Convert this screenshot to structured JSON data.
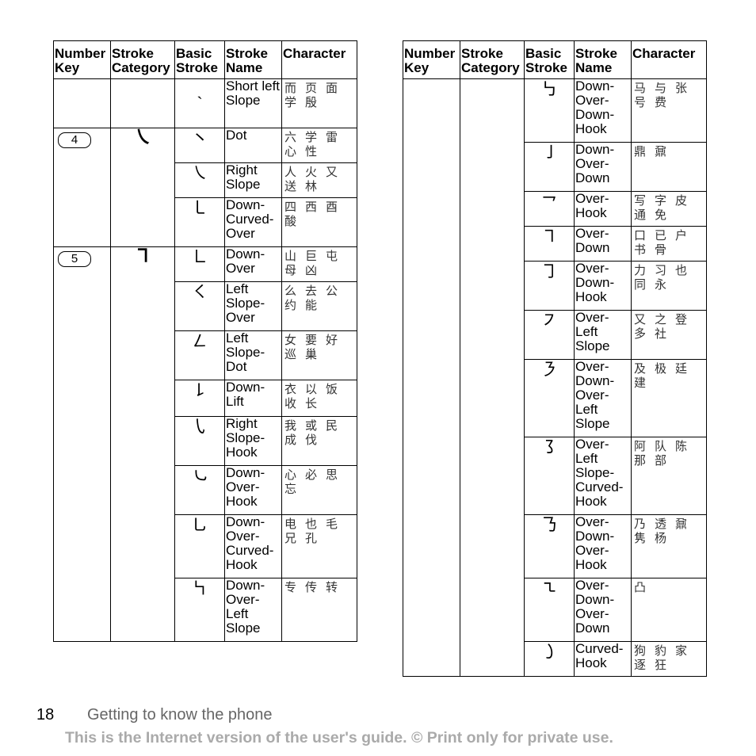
{
  "headers": [
    "Number Key",
    "Stroke Category",
    "Basic Stroke",
    "Stroke Name",
    "Character"
  ],
  "left_table": {
    "rows": [
      {
        "key": "",
        "category": "",
        "stroke": "ˏ",
        "name": "Short left Slope",
        "chars": [
          "而",
          "页",
          "面",
          "学",
          "殷"
        ]
      },
      {
        "key": "4",
        "category": "㇏",
        "stroke": "㇔",
        "name": "Dot",
        "chars": [
          "六",
          "学",
          "雷",
          "心",
          "性"
        ]
      },
      {
        "key": "",
        "category": "",
        "stroke": "㇏",
        "name": "Right Slope",
        "chars": [
          "人",
          "火",
          "又",
          "送",
          "林"
        ]
      },
      {
        "key": "",
        "category": "",
        "stroke": "㇄",
        "name": "Down-Curved-Over",
        "chars": [
          "四",
          "西",
          "酉",
          "酸"
        ]
      },
      {
        "key": "5",
        "category": "㇕",
        "stroke": "㇗",
        "name": "Down-Over",
        "chars": [
          "山",
          "巨",
          "屯",
          "母",
          "凶"
        ]
      },
      {
        "key": "",
        "category": "",
        "stroke": "㇛",
        "name": "Left Slope-Over",
        "chars": [
          "么",
          "去",
          "公",
          "约",
          "能"
        ]
      },
      {
        "key": "",
        "category": "",
        "stroke": "㇜",
        "name": "Left Slope-Dot",
        "chars": [
          "女",
          "要",
          "好",
          "巡",
          "巢"
        ]
      },
      {
        "key": "",
        "category": "",
        "stroke": "㇙",
        "name": "Down-Lift",
        "chars": [
          "衣",
          "以",
          "饭",
          "收",
          "长"
        ]
      },
      {
        "key": "",
        "category": "",
        "stroke": "㇂",
        "name": "Right Slope-Hook",
        "chars": [
          "我",
          "或",
          "民",
          "成",
          "伐"
        ]
      },
      {
        "key": "",
        "category": "",
        "stroke": "㇃",
        "name": "Down-Over-Hook",
        "chars": [
          "心",
          "必",
          "思",
          "忘"
        ]
      },
      {
        "key": "",
        "category": "",
        "stroke": "㇟",
        "name": "Down-Over-Curved-Hook",
        "chars": [
          "电",
          "也",
          "毛",
          "兄",
          "孔"
        ]
      },
      {
        "key": "",
        "category": "",
        "stroke": "㇞",
        "name": "Down-Over-Left Slope",
        "chars": [
          "专",
          "传",
          "转"
        ]
      }
    ]
  },
  "right_table": {
    "rows": [
      {
        "stroke": "㇉",
        "name": "Down-Over-Down-Hook",
        "chars": [
          "马",
          "与",
          "张",
          "号",
          "费"
        ]
      },
      {
        "stroke": "㇚",
        "name": "Down-Over-Down",
        "chars": [
          "鼎",
          "鼐"
        ]
      },
      {
        "stroke": "㇖",
        "name": "Over-Hook",
        "chars": [
          "写",
          "字",
          "皮",
          "通",
          "免"
        ]
      },
      {
        "stroke": "㇕",
        "name": "Over-Down",
        "chars": [
          "口",
          "已",
          "户",
          "书",
          "骨"
        ]
      },
      {
        "stroke": "㇆",
        "name": "Over-Down-Hook",
        "chars": [
          "力",
          "习",
          "也",
          "同",
          "永"
        ]
      },
      {
        "stroke": "㇇",
        "name": "Over-Left Slope",
        "chars": [
          "又",
          "之",
          "登",
          "多",
          "社"
        ]
      },
      {
        "stroke": "㇋",
        "name": "Over-Down-Over-Left Slope",
        "chars": [
          "及",
          "极",
          "廷",
          "建"
        ]
      },
      {
        "stroke": "㇌",
        "name": "Over-Left Slope-Curved-Hook",
        "chars": [
          "阿",
          "队",
          "陈",
          "那",
          "部"
        ]
      },
      {
        "stroke": "㇡",
        "name": "Over-Down-Over-Hook",
        "chars": [
          "乃",
          "透",
          "鼐",
          "隽",
          "杨"
        ]
      },
      {
        "stroke": "㇍",
        "name": "Over-Down-Over-Down",
        "chars": [
          "凸"
        ]
      },
      {
        "stroke": "㇁",
        "name": "Curved-Hook",
        "chars": [
          "狗",
          "豹",
          "家",
          "逐",
          "狂"
        ]
      }
    ]
  },
  "footer": {
    "page_number": "18",
    "section_title": "Getting to know the phone",
    "note": "This is the Internet version of the user's guide. © Print only for private use."
  }
}
